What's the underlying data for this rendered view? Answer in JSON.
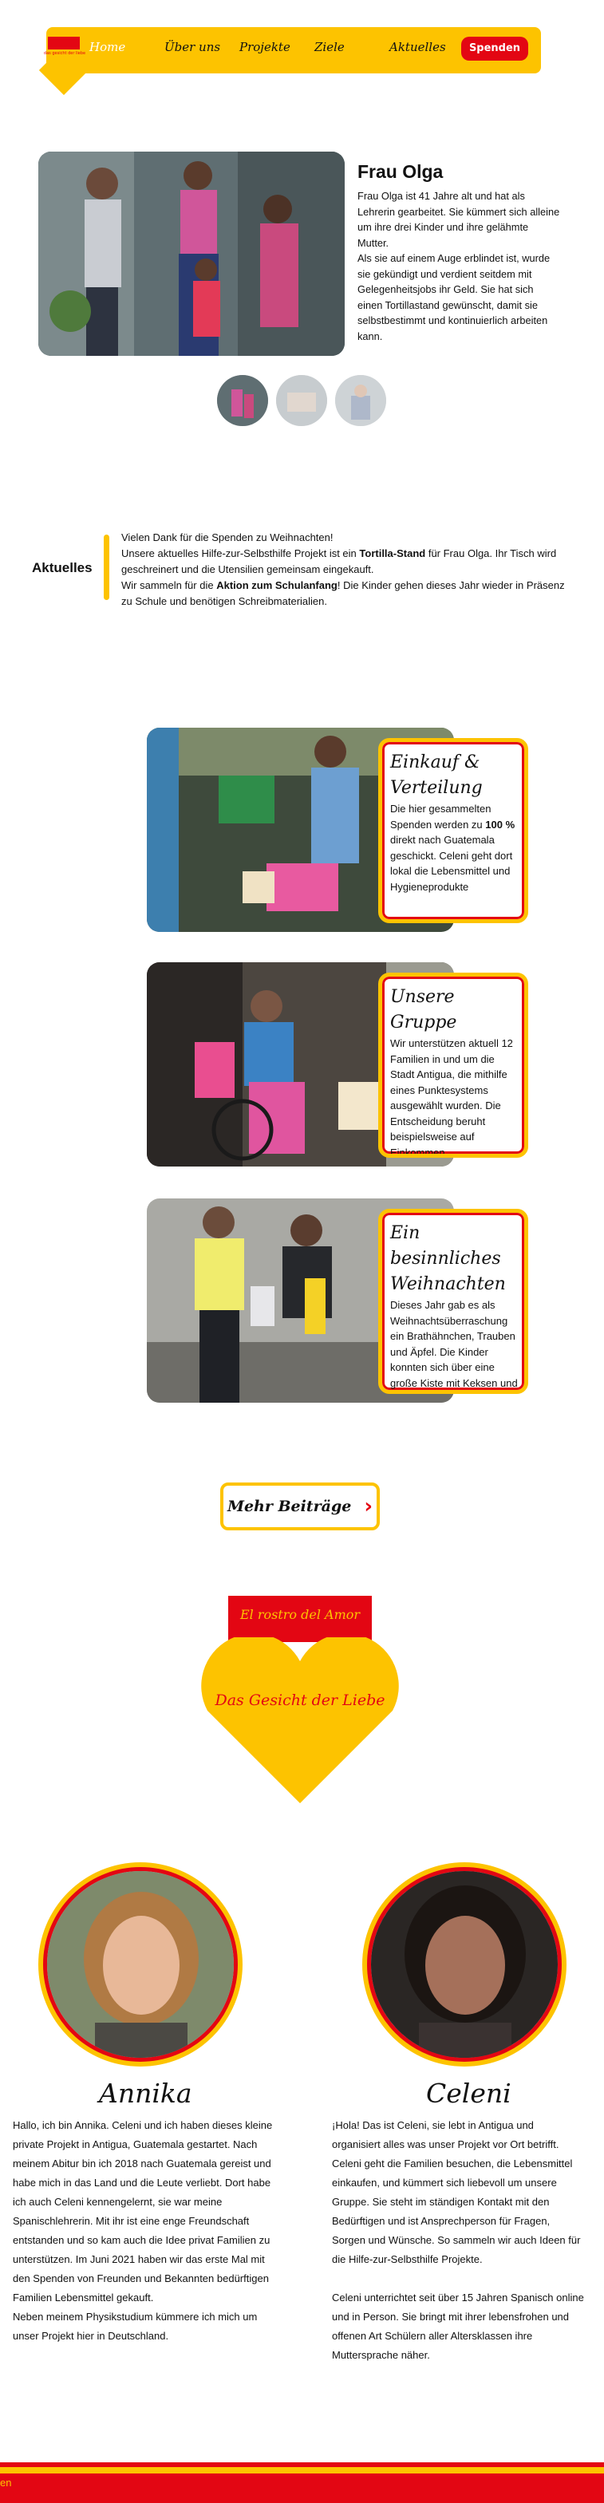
{
  "nav": {
    "logo_sub": "das gesicht der liebe",
    "links": [
      "Home",
      "Über uns",
      "Projekte",
      "Ziele",
      "Aktuelles"
    ],
    "donate_label": "Spenden"
  },
  "profile": {
    "title": "Frau Olga",
    "text": [
      "Frau Olga ist 41 Jahre alt und hat als Lehrerin gearbeitet. Sie kümmert sich alleine um ihre drei Kinder und ihre gelähmte Mutter.",
      "Als sie auf einem Auge erblindet ist, wurde sie gekündigt und verdient seitdem mit Gelegenheitsjobs ihr Geld. Sie hat sich einen Tortillastand gewünscht, damit sie selbstbestimmt und kontinuierlich arbeiten kann."
    ]
  },
  "aktuelles": {
    "title": "Aktuelles",
    "line1": "Vielen Dank für die Spenden zu Weihnachten!",
    "line2_a": "Unsere aktuelles Hilfe-zur-Selbsthilfe Projekt ist ein ",
    "line2_b": "Tortilla-Stand",
    "line2_c": " für Frau Olga. Ihr Tisch wird geschreinert und die Utensilien gemeinsam eingekauft.",
    "line3_a": "Wir sammeln für die ",
    "line3_b": "Aktion zum Schulanfang",
    "line3_c": "! Die Kinder gehen dieses Jahr wieder in Präsenz zu Schule und benötigen Schreibmaterialien."
  },
  "cards": [
    {
      "title": "Einkauf & Verteilung",
      "text_a": "Die hier gesammelten Spenden werden zu ",
      "text_b": "100 %",
      "text_c": " direkt nach Guatemala geschickt. Celeni geht dort lokal die Lebensmittel und Hygieneprodukte"
    },
    {
      "title": "Unsere Gruppe",
      "text_a": "Wir unterstützen aktuell 12 Familien in und um die Stadt Antigua, die mithilfe eines Punktesystems ausgewählt wurden. Die Entscheidung beruht beispielsweise auf Einkommen,",
      "text_b": "",
      "text_c": ""
    },
    {
      "title": "Ein besinnliches Weihnachten",
      "text_a": "Dieses Jahr gab es als Weihnachtsüberraschung ein Brathähnchen, Trauben und Äpfel. Die Kinder konnten sich über eine große Kiste mit Keksen und",
      "text_b": "",
      "text_c": ""
    }
  ],
  "more_label": "Mehr Beiträge",
  "brand": {
    "spanish": "El rostro del Amor",
    "german": "Das Gesicht der Liebe"
  },
  "team": [
    {
      "name": "Annika",
      "text": [
        "Hallo, ich bin Annika. Celeni und ich haben dieses kleine private Projekt in Antigua, Guatemala gestartet. Nach meinem Abitur bin ich 2018 nach Guatemala gereist und habe mich in das Land und die Leute verliebt. Dort habe ich auch Celeni kennengelernt, sie war meine Spanischlehrerin. Mit ihr ist eine enge Freundschaft entstanden und so kam auch die Idee privat Familien zu unterstützen. Im Juni 2021 haben wir das erste Mal mit den Spenden von Freunden und Bekannten bedürftigen Familien Lebensmittel gekauft.",
        "Neben meinem Physikstudium kümmere ich mich um unser Projekt hier in Deutschland."
      ]
    },
    {
      "name": "Celeni",
      "text": [
        "¡Hola! Das ist Celeni, sie lebt in Antigua und organisiert alles was unser Projekt vor Ort betrifft. Celeni geht die Familien besuchen, die Lebensmittel einkaufen, und kümmert sich liebevoll um unsere Gruppe. Sie steht im ständigen Kontakt mit den Bedürftigen und ist Ansprechperson für Fragen, Sorgen und Wünsche. So sammeln wir auch Ideen für die Hilfe-zur-Selbsthilfe Projekte.",
        "Celeni unterrichtet seit über 15 Jahren Spanisch online und in Person. Sie bringt mit ihrer lebensfrohen und offenen Art Schülern aller Altersklassen ihre Muttersprache näher."
      ]
    }
  ],
  "footer": {
    "link": "en"
  },
  "colors": {
    "yellow": "#fdc300",
    "red": "#e30613"
  }
}
